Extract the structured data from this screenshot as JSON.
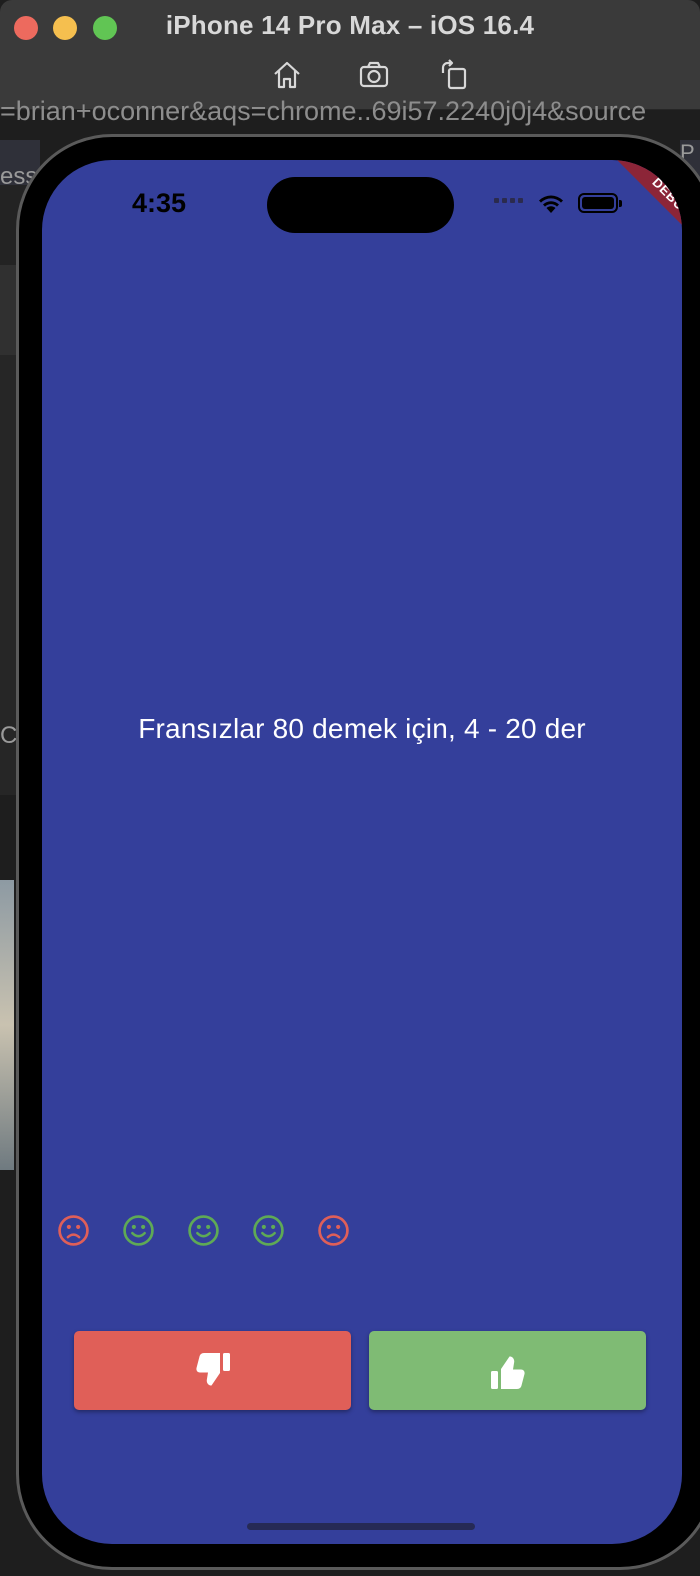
{
  "window": {
    "title": "iPhone 14 Pro Max – iOS 16.4",
    "toolbar": {
      "home_icon": "home-icon",
      "screenshot_icon": "camera-icon",
      "rotate_icon": "rotate-icon"
    }
  },
  "background": {
    "url_fragment": "=brian+oconner&aqs=chrome..69i57.2240j0j4&source",
    "left_text_1": "ess",
    "left_text_2": "Ca",
    "right_text": "P"
  },
  "status_bar": {
    "time": "4:35",
    "wifi_icon": "wifi-icon",
    "battery_icon": "battery-icon"
  },
  "debug_banner": "DEBUG",
  "quiz": {
    "question": "Fransızlar 80 demek için, 4 - 20 der",
    "score_keeper": [
      {
        "icon": "sad-face-icon",
        "result": "wrong",
        "color": "#e05f58"
      },
      {
        "icon": "smile-face-icon",
        "result": "correct",
        "color": "#5faa55"
      },
      {
        "icon": "smile-face-icon",
        "result": "correct",
        "color": "#5faa55"
      },
      {
        "icon": "smile-face-icon",
        "result": "correct",
        "color": "#5faa55"
      },
      {
        "icon": "sad-face-icon",
        "result": "wrong",
        "color": "#e05f58"
      }
    ],
    "false_button": {
      "icon": "thumbs-down-icon",
      "color": "#e05f58"
    },
    "true_button": {
      "icon": "thumbs-up-icon",
      "color": "#7fbb74"
    }
  },
  "colors": {
    "screen_background": "#343f9b",
    "debug_banner": "#8c2538"
  }
}
